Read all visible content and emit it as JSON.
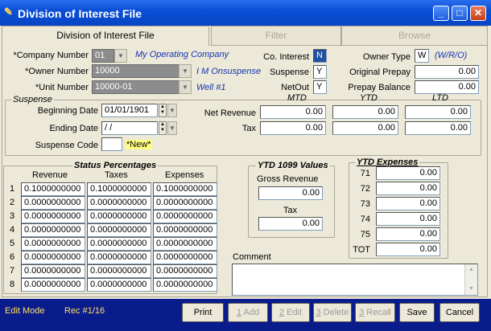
{
  "window": {
    "title": "Division of Interest File"
  },
  "tabs": [
    {
      "label": "Division of Interest File"
    },
    {
      "label": "Filter"
    },
    {
      "label": "Browse"
    }
  ],
  "company": {
    "label": "*Company Number",
    "value": "01",
    "name": "My Operating Company"
  },
  "owner": {
    "label": "*Owner Number",
    "value": "10000",
    "name": "I M Onsuspense"
  },
  "unit": {
    "label": "*Unit Number",
    "value": "10000-01",
    "name": "Well #1"
  },
  "flags": {
    "co_interest_label": "Co. Interest",
    "co_interest": "N",
    "suspense_label": "Suspense",
    "suspense": "Y",
    "netout_label": "NetOut",
    "netout": "Y"
  },
  "owner_type": {
    "label": "Owner Type",
    "value": "W",
    "hint": "(W/R/O)"
  },
  "prepay": {
    "original_label": "Original Prepay",
    "original": "0.00",
    "balance_label": "Prepay Balance",
    "balance": "0.00"
  },
  "suspense": {
    "title": "Suspense",
    "begin_label": "Beginning Date",
    "begin": "01/01/1901",
    "end_label": "Ending Date",
    "end": " / /",
    "code_label": "Suspense Code",
    "code": "",
    "new_badge": "*New*"
  },
  "totals": {
    "headers": [
      "MTD",
      "YTD",
      "LTD"
    ],
    "net_revenue_label": "Net Revenue",
    "net_revenue": [
      "0.00",
      "0.00",
      "0.00"
    ],
    "tax_label": "Tax",
    "tax": [
      "0.00",
      "0.00",
      "0.00"
    ]
  },
  "status": {
    "title": "Status Percentages",
    "headers": [
      "Revenue",
      "Taxes",
      "Expenses"
    ],
    "rows": [
      {
        "n": "1",
        "v": [
          "0.1000000000",
          "0.1000000000",
          "0.1000000000"
        ]
      },
      {
        "n": "2",
        "v": [
          "0.0000000000",
          "0.0000000000",
          "0.0000000000"
        ]
      },
      {
        "n": "3",
        "v": [
          "0.0000000000",
          "0.0000000000",
          "0.0000000000"
        ]
      },
      {
        "n": "4",
        "v": [
          "0.0000000000",
          "0.0000000000",
          "0.0000000000"
        ]
      },
      {
        "n": "5",
        "v": [
          "0.0000000000",
          "0.0000000000",
          "0.0000000000"
        ]
      },
      {
        "n": "6",
        "v": [
          "0.0000000000",
          "0.0000000000",
          "0.0000000000"
        ]
      },
      {
        "n": "7",
        "v": [
          "0.0000000000",
          "0.0000000000",
          "0.0000000000"
        ]
      },
      {
        "n": "8",
        "v": [
          "0.0000000000",
          "0.0000000000",
          "0.0000000000"
        ]
      }
    ]
  },
  "ytd1099": {
    "title": "YTD 1099 Values",
    "gross_label": "Gross Revenue",
    "gross": "0.00",
    "tax_label": "Tax",
    "tax": "0.00"
  },
  "ytd_expenses": {
    "title": "YTD Expenses",
    "rows": [
      {
        "label": "71",
        "value": "0.00"
      },
      {
        "label": "72",
        "value": "0.00"
      },
      {
        "label": "73",
        "value": "0.00"
      },
      {
        "label": "74",
        "value": "0.00"
      },
      {
        "label": "75",
        "value": "0.00"
      },
      {
        "label": "TOT",
        "value": "0.00"
      }
    ]
  },
  "comment": {
    "label": "Comment",
    "value": ""
  },
  "statusbar": {
    "mode": "Edit Mode",
    "record": "Rec #1/16"
  },
  "buttons": {
    "print": "Print",
    "add_key": "1",
    "add": " Add",
    "edit_key": "2",
    "edit": " Edit",
    "delete_key": "3",
    "delete": " Delete",
    "recall_key": "3",
    "recall": " Recall",
    "save": "Save",
    "cancel": "Cancel"
  }
}
